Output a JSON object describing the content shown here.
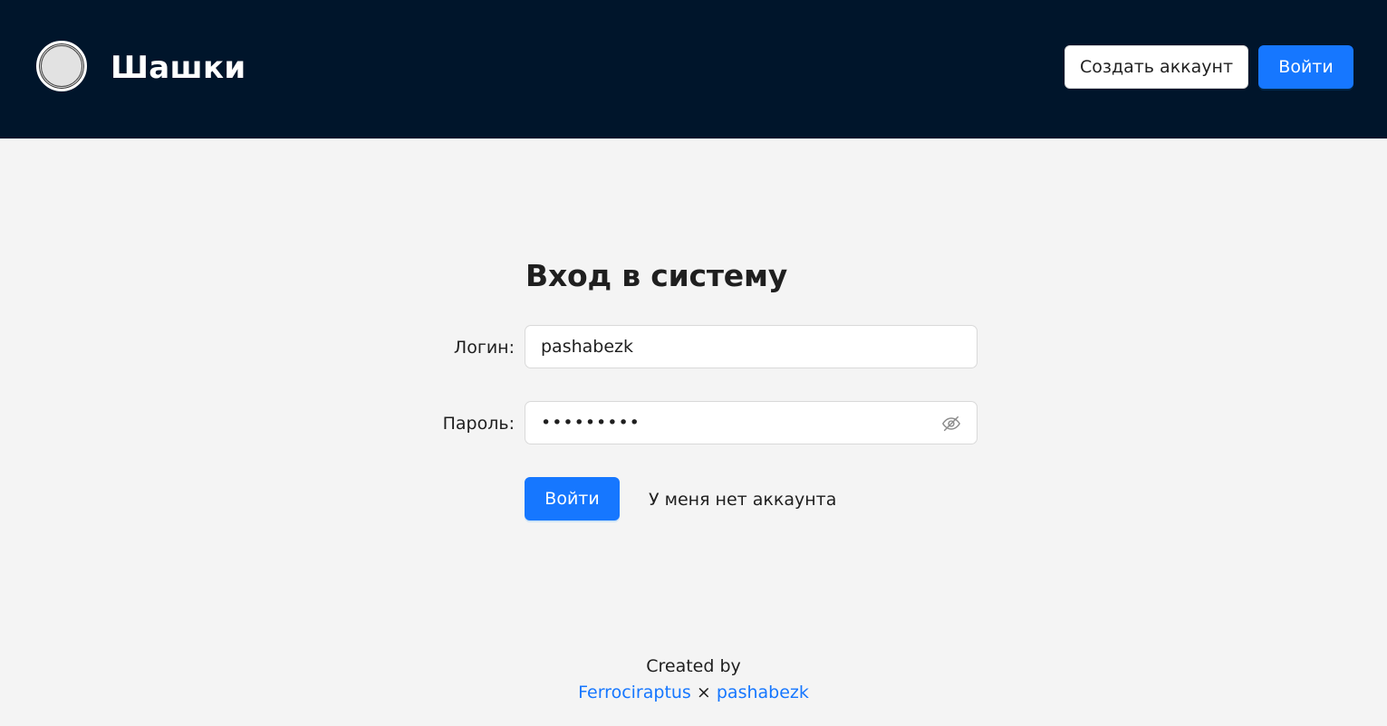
{
  "header": {
    "title": "Шашки",
    "create_account_label": "Создать аккаунт",
    "login_label": "Войти"
  },
  "form": {
    "title": "Вход в систему",
    "login_label": "Логин",
    "login_value": "pashabezk",
    "password_label": "Пароль",
    "password_masked": "•••••••••",
    "submit_label": "Войти",
    "no_account_label": "У меня нет аккаунта"
  },
  "footer": {
    "created_by": "Created by",
    "author1": "Ferrociraptus",
    "separator": "×",
    "author2": "pashabezk"
  },
  "colors": {
    "header_bg": "#00152b",
    "primary": "#1677ff",
    "page_bg": "#f4f4f4"
  },
  "icons": {
    "logo": "checker-piece-icon",
    "password_toggle": "eye-slash-icon"
  }
}
